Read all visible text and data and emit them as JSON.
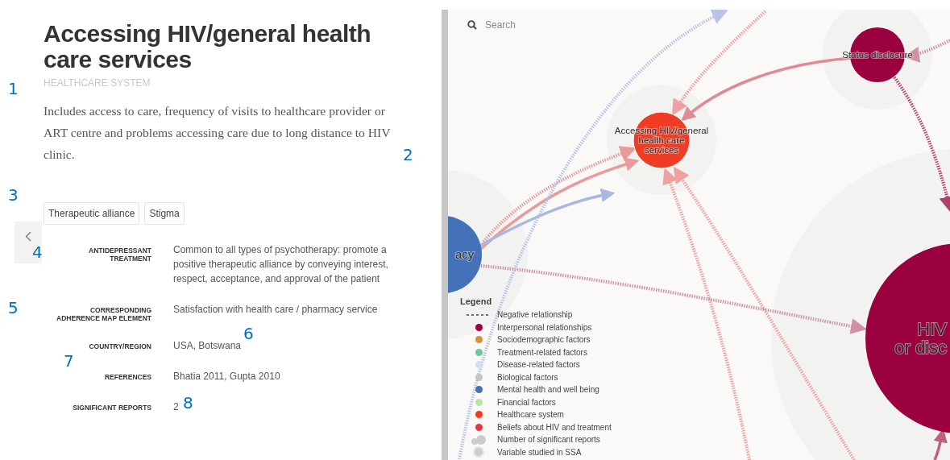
{
  "detail": {
    "title": "Accessing HIV/general health care services",
    "category": "HEALTHCARE SYSTEM",
    "description": "Includes access to care, frequency of visits to healthcare provider or ART centre and problems accessing care due to long distance to HIV clinic.",
    "tags": [
      "Therapeutic alliance",
      "Stigma"
    ],
    "fields": [
      {
        "label": "ANTIDEPRESSANT TREATMENT",
        "value": "Common to all types of psychotherapy: promote a positive therapeutic alliance by conveying interest, respect, acceptance, and approval of the patient"
      },
      {
        "label": "CORRESPONDING ADHERENCE MAP ELEMENT",
        "value": "Satisfaction with health care / pharmacy service"
      },
      {
        "label": "COUNTRY/REGION",
        "value": "USA, Botswana"
      },
      {
        "label": "REFERENCES",
        "value": "Bhatia 2011, Gupta 2010"
      },
      {
        "label": "SIGNIFICANT REPORTS",
        "value": "2"
      }
    ]
  },
  "annotations": [
    "1",
    "2",
    "3",
    "4",
    "5",
    "6",
    "7",
    "8"
  ],
  "map": {
    "search": {
      "placeholder": "Search"
    },
    "nodes": [
      {
        "label": [
          "acy"
        ],
        "color": "#4472b8"
      },
      {
        "label": [
          "Accessing HIV/general",
          "health care",
          "services"
        ],
        "color": "#f03c24"
      },
      {
        "label": [
          "Status disclosure"
        ],
        "color": "#9b003f"
      },
      {
        "label": [
          "HIV",
          "or disc"
        ],
        "color": "#9b003f"
      }
    ],
    "legend": {
      "title": "Legend",
      "items": [
        {
          "kind": "dashed",
          "label": "Negative relationship"
        },
        {
          "kind": "dot",
          "color": "#9b003f",
          "label": "Interpersonal relationships"
        },
        {
          "kind": "dot",
          "color": "#d4903a",
          "label": "Sociodemographic factors"
        },
        {
          "kind": "dot",
          "color": "#6cc79a",
          "label": "Treatment-related factors"
        },
        {
          "kind": "dot",
          "color": "#cfe0f3",
          "label": "Disease-related factors"
        },
        {
          "kind": "dot",
          "color": "#c4c4c4",
          "label": "Biological factors"
        },
        {
          "kind": "dot",
          "color": "#4472b8",
          "label": "Mental health and well being"
        },
        {
          "kind": "dot",
          "color": "#b8e6a0",
          "label": "Financial factors"
        },
        {
          "kind": "dot",
          "color": "#f03c24",
          "label": "Healthcare system"
        },
        {
          "kind": "dot",
          "color": "#dc3b4a",
          "label": "Beliefs about HIV and treatment"
        },
        {
          "kind": "cloud",
          "label": "Number of significant reports"
        },
        {
          "kind": "ring",
          "label": "Variable studied in SSA"
        }
      ]
    }
  }
}
